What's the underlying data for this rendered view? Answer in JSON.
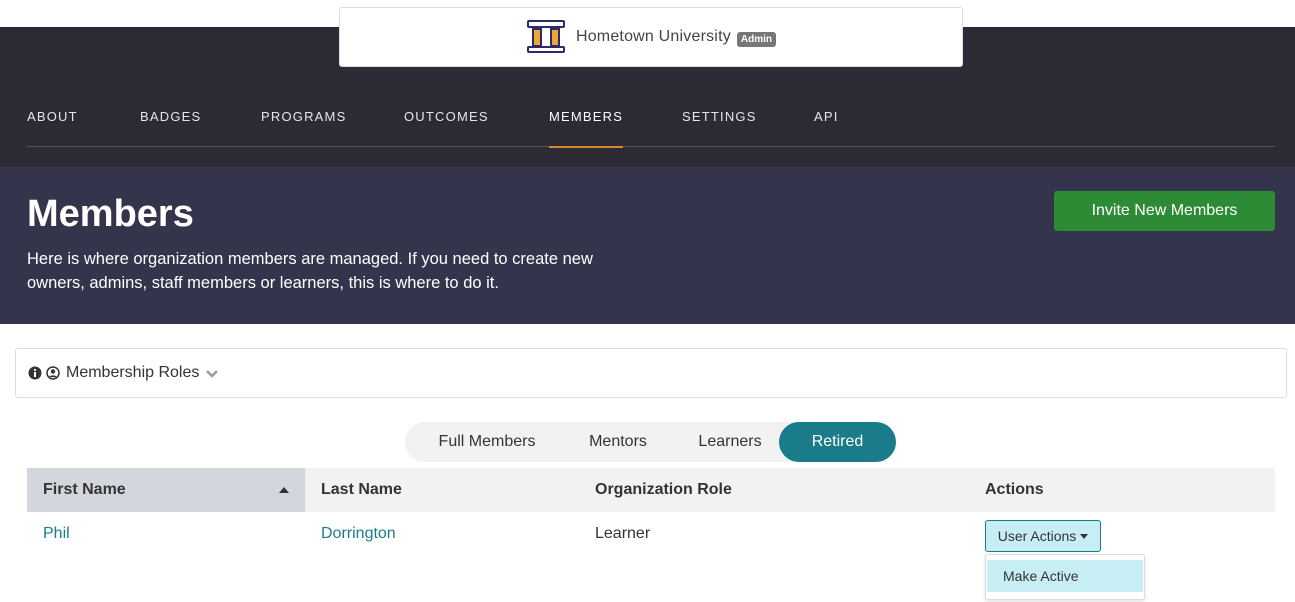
{
  "brand": {
    "name": "Hometown University",
    "badge": "Admin"
  },
  "nav": {
    "items": [
      {
        "label": "ABOUT"
      },
      {
        "label": "BADGES"
      },
      {
        "label": "PROGRAMS"
      },
      {
        "label": "OUTCOMES"
      },
      {
        "label": "MEMBERS",
        "active": true
      },
      {
        "label": "SETTINGS"
      },
      {
        "label": "API"
      }
    ]
  },
  "hero": {
    "title": "Members",
    "description": "Here is where organization members are managed. If you need to create new owners, admins, staff members or learners, this is where to do it.",
    "invite_label": "Invite New Members",
    "invite_color": "#2e8b35"
  },
  "roles": {
    "label": "Membership Roles",
    "icons": [
      "info-icon",
      "user-circle-icon",
      "chevron-down-icon"
    ]
  },
  "tabs": [
    {
      "label": "Full Members"
    },
    {
      "label": "Mentors"
    },
    {
      "label": "Learners"
    },
    {
      "label": "Retired",
      "active": true
    }
  ],
  "table": {
    "columns": [
      "First Name",
      "Last Name",
      "Organization Role",
      "Actions"
    ],
    "sorted_column": "First Name",
    "rows": [
      {
        "first_name": "Phil",
        "last_name": "Dorrington",
        "role": "Learner"
      }
    ],
    "actions_label": "User Actions",
    "menu": [
      "Make Active"
    ]
  },
  "colors": {
    "nav_bg": "#2c2a35",
    "hero_bg": "#34344d",
    "accent": "#1a7c8a",
    "active_underline": "#d88a2b"
  }
}
